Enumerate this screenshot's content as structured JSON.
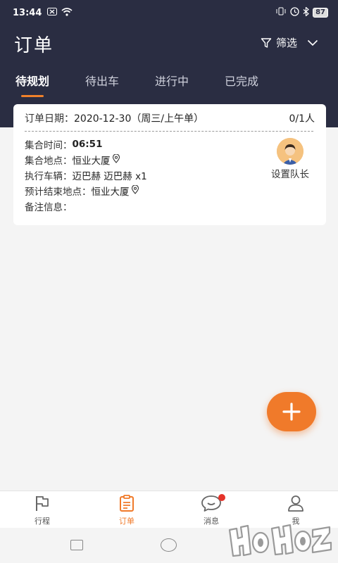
{
  "status_bar": {
    "time": "13:44",
    "battery": "87",
    "icons": [
      "notification-icon",
      "wifi-icon",
      "vibrate-icon",
      "alarm-icon",
      "bluetooth-icon",
      "battery-icon"
    ]
  },
  "header": {
    "title": "订单",
    "filter_label": "筛选"
  },
  "tabs": [
    {
      "label": "待规划",
      "active": true
    },
    {
      "label": "待出车",
      "active": false
    },
    {
      "label": "进行中",
      "active": false
    },
    {
      "label": "已完成",
      "active": false
    }
  ],
  "order": {
    "date_label": "订单日期：",
    "date_value": "2020-12-30（周三/上午单）",
    "count": "0/1人",
    "rows": [
      {
        "label": "集合时间：",
        "value": "06:51",
        "pin": false
      },
      {
        "label": "集合地点：",
        "value": "恒业大厦",
        "pin": true
      },
      {
        "label": "执行车辆：",
        "value": "迈巴赫 迈巴赫 x1",
        "pin": false
      },
      {
        "label": "预计结束地点：",
        "value": "恒业大厦",
        "pin": true
      },
      {
        "label": "备注信息：",
        "value": "",
        "pin": false
      }
    ],
    "leader_label": "设置队长"
  },
  "bottom_nav": [
    {
      "label": "行程",
      "icon": "flag-icon",
      "active": false
    },
    {
      "label": "订单",
      "icon": "clipboard-icon",
      "active": true
    },
    {
      "label": "消息",
      "icon": "chat-icon",
      "active": false,
      "badge": true
    },
    {
      "label": "我",
      "icon": "user-icon",
      "active": false
    }
  ],
  "colors": {
    "header_bg": "#2a2d42",
    "accent": "#f07a2a",
    "badge": "#e5332a"
  }
}
